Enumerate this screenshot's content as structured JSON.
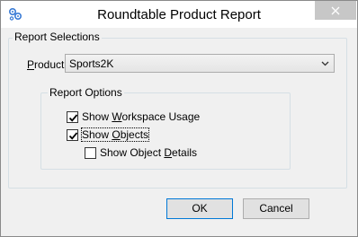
{
  "window": {
    "title": "Roundtable Product Report",
    "close_glyph": "×",
    "icon": "gear-cluster-icon"
  },
  "report_selections": {
    "label": "Report Selections",
    "product_label_underlined": "P",
    "product_label_rest": "roduct:",
    "product_value": "Sports2K"
  },
  "report_options": {
    "label": "Report Options",
    "options": [
      {
        "pre": "Show ",
        "ul": "W",
        "post": "orkspace Usage",
        "checked": true
      },
      {
        "pre": "Show ",
        "ul": "O",
        "post": "bjects",
        "checked": true
      },
      {
        "pre": "Show Object ",
        "ul": "D",
        "post": "etails",
        "checked": false
      }
    ]
  },
  "buttons": {
    "ok": "OK",
    "cancel": "Cancel"
  }
}
